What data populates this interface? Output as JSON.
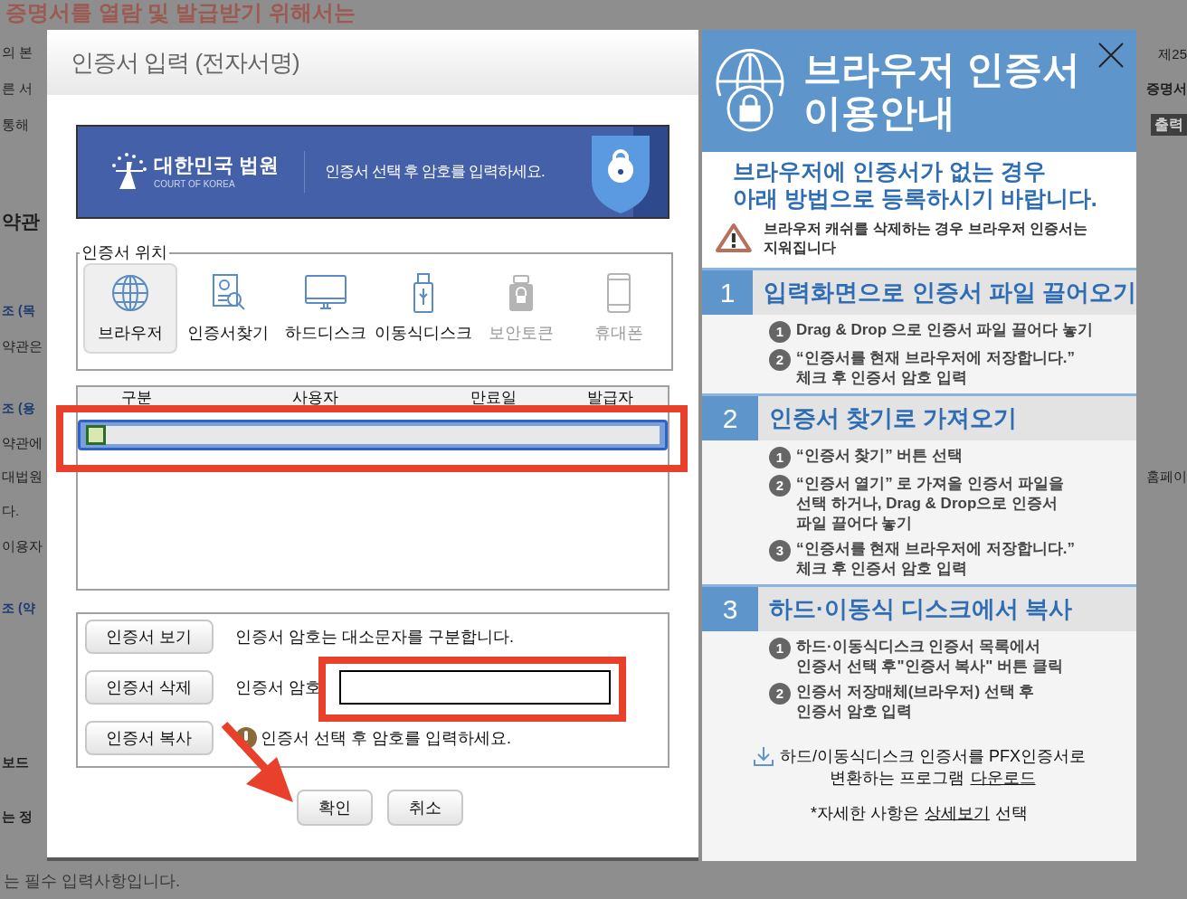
{
  "background": {
    "heading": "증명서를 열람 및 발급받기 위해서는",
    "left": [
      {
        "text": "의 본",
        "kind": "plain"
      },
      {
        "text": "른 서",
        "kind": "plain"
      },
      {
        "text": "통해",
        "kind": "plain"
      },
      {
        "text": "약관",
        "kind": "heading"
      },
      {
        "text": "조 (목",
        "kind": "link"
      },
      {
        "text": "약관은",
        "kind": "plain"
      },
      {
        "text": "조 (용",
        "kind": "link"
      },
      {
        "text": "약관에",
        "kind": "plain"
      },
      {
        "text": "대법원",
        "kind": "plain"
      },
      {
        "text": "다.",
        "kind": "plain"
      },
      {
        "text": "이용자",
        "kind": "plain"
      },
      {
        "text": "조 (약",
        "kind": "link"
      },
      {
        "text": "보드",
        "kind": "bold"
      },
      {
        "text": "는 정",
        "kind": "bold"
      }
    ],
    "right": [
      {
        "text": "제25",
        "kind": "plain"
      },
      {
        "text": "증명서",
        "kind": "bold"
      },
      {
        "text": "출력",
        "kind": "dark"
      },
      {
        "text": "홈페이",
        "kind": "plain"
      }
    ],
    "footer": "는 필수 입력사항입니다."
  },
  "dialog": {
    "title": "인증서 입력 (전자서명)",
    "banner": {
      "logo": "대한민국 법원",
      "logo_sub": "COURT OF KOREA",
      "message": "인증서 선택 후 암호를 입력하세요."
    },
    "location": {
      "legend": "인증서 위치",
      "options": [
        {
          "label": "브라우저",
          "kind": "globe",
          "selected": true,
          "disabled": false
        },
        {
          "label": "인증서찾기",
          "kind": "find",
          "selected": false,
          "disabled": false
        },
        {
          "label": "하드디스크",
          "kind": "monitor",
          "selected": false,
          "disabled": false
        },
        {
          "label": "이동식디스크",
          "kind": "usb",
          "selected": false,
          "disabled": false
        },
        {
          "label": "보안토큰",
          "kind": "token",
          "selected": false,
          "disabled": true
        },
        {
          "label": "휴대폰",
          "kind": "phone",
          "selected": false,
          "disabled": true
        }
      ]
    },
    "table": {
      "columns": [
        "구분",
        "사용자",
        "만료일",
        "발급자"
      ],
      "rows": [
        {
          "selected": true
        }
      ]
    },
    "actions": [
      "인증서 보기",
      "인증서 삭제",
      "인증서 복사"
    ],
    "case_note": "인증서 암호는 대소문자를 구분합니다.",
    "password": {
      "label": "인증서 암호"
    },
    "warning": "인증서 선택 후 암호를 입력하세요.",
    "buttons": [
      "확인",
      "취소"
    ]
  },
  "guide": {
    "title": [
      "브라우저 인증서",
      "이용안내"
    ],
    "subtitle": [
      "브라우저에 인증서가 없는 경우",
      "아래 방법으로 등록하시기 바랍니다."
    ],
    "caution": "브라우저 캐쉬를 삭제하는 경우 브라우저 인증서는 지워집니다",
    "sections": [
      {
        "number": "1",
        "title": "입력화면으로 인증서 파일 끌어오기",
        "steps": [
          {
            "num": "1",
            "lines": [
              "Drag & Drop 으로 인증서 파일 끌어다 놓기"
            ]
          },
          {
            "num": "2",
            "lines": [
              "“인증서를 현재 브라우저에 저장합니다.”",
              "체크 후 인증서 암호 입력"
            ]
          }
        ]
      },
      {
        "number": "2",
        "title": "인증서 찾기로 가져오기",
        "steps": [
          {
            "num": "1",
            "lines": [
              "“인증서 찾기” 버튼 선택"
            ]
          },
          {
            "num": "2",
            "lines": [
              "“인증서 열기” 로 가져올 인증서 파일을",
              "선택 하거나, Drag & Drop으로 인증서",
              "파일 끌어다 놓기"
            ]
          },
          {
            "num": "3",
            "lines": [
              "“인증서를 현재 브라우저에 저장합니다.”",
              "체크 후 인증서 암호 입력"
            ]
          }
        ]
      },
      {
        "number": "3",
        "title": "하드·이동식 디스크에서 복사",
        "steps": [
          {
            "num": "1",
            "lines": [
              "하드·이동식디스크 인증서 목록에서",
              "인증서 선택 후\"인증서 복사\" 버튼 클릭"
            ]
          },
          {
            "num": "2",
            "lines": [
              "인증서 저장매체(브라우저) 선택 후",
              "인증서 암호 입력"
            ]
          }
        ]
      }
    ],
    "download": {
      "line1": "하드/이동식디스크 인증서를 PFX인증서로",
      "line2": "변환하는 프로그램",
      "link": "다운로드"
    },
    "detail": {
      "before": "*자세한 사항은",
      "link": "상세보기",
      "after": "선택"
    }
  }
}
